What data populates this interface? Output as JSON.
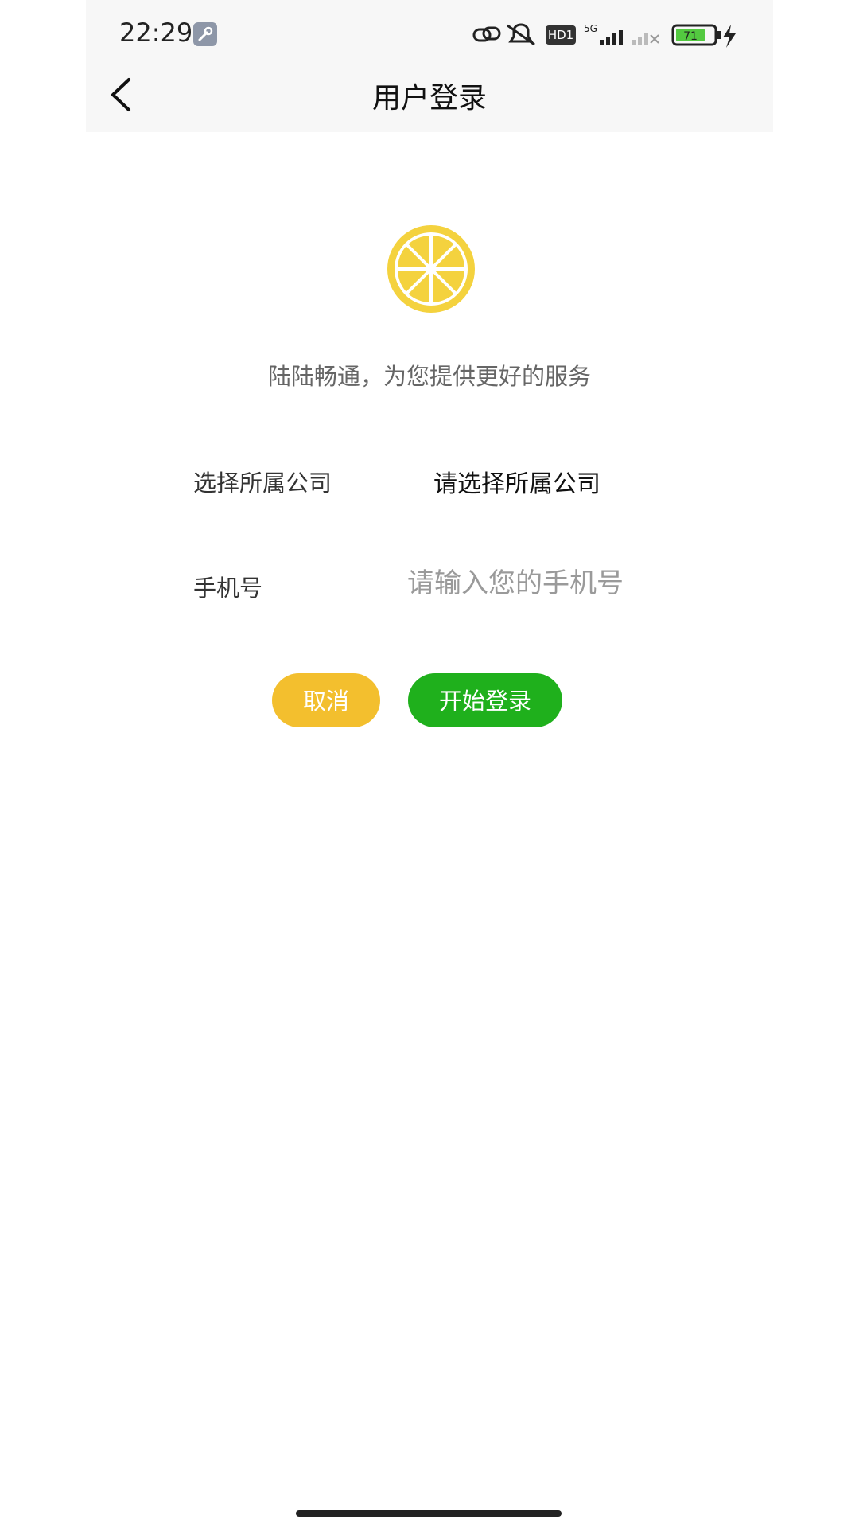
{
  "status_bar": {
    "time": "22:29",
    "hd_badge": "HD1",
    "network": "5G",
    "battery": "71"
  },
  "header": {
    "title": "用户登录"
  },
  "brand": {
    "slogan": "陆陆畅通，为您提供更好的服务"
  },
  "form": {
    "company_label": "选择所属公司",
    "company_value": "请选择所属公司",
    "phone_label": "手机号",
    "phone_placeholder": "请输入您的手机号",
    "phone_value": ""
  },
  "actions": {
    "cancel_label": "取消",
    "login_label": "开始登录"
  },
  "colors": {
    "cancel_bg": "#f3bf2e",
    "login_bg": "#1fb01c",
    "logo_yellow": "#f4d23e"
  }
}
